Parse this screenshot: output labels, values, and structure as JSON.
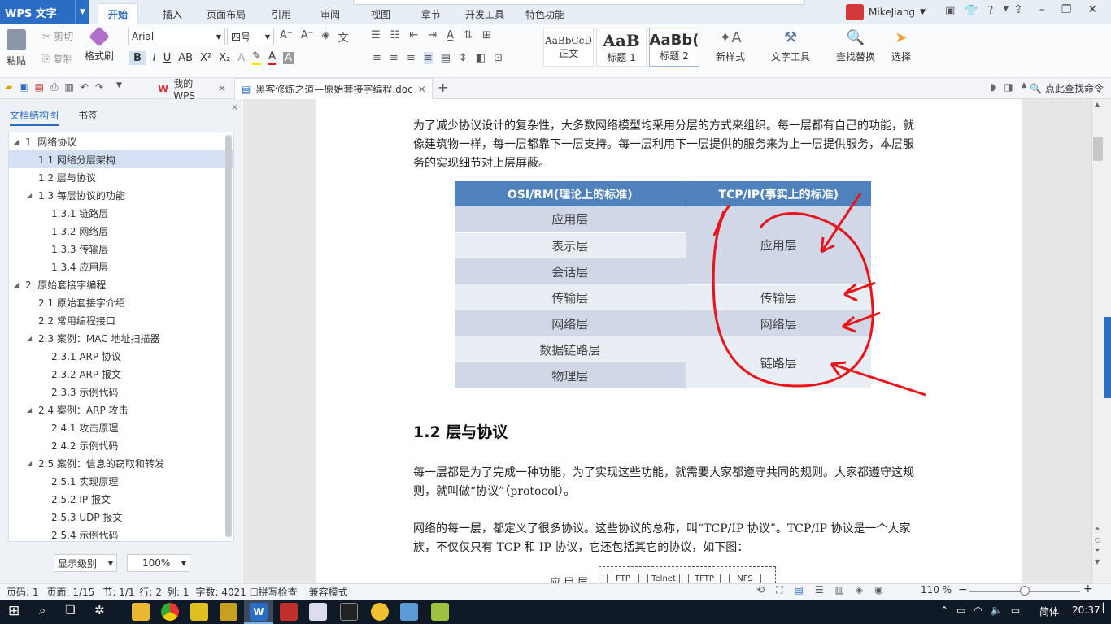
{
  "app": {
    "logo_text": "WPS 文字"
  },
  "menu_tabs": [
    "开始",
    "插入",
    "页面布局",
    "引用",
    "审阅",
    "视图",
    "章节",
    "开发工具",
    "特色功能"
  ],
  "user": {
    "name": "MikeJiang",
    "help": "?"
  },
  "ribbon": {
    "paste": "粘贴",
    "cut": "剪切",
    "copy": "复制",
    "format_painter": "格式刷",
    "font_name": "Arial",
    "font_size": "四号",
    "bold": "B",
    "italic": "I",
    "underline": "U",
    "styles": [
      {
        "preview": "AaBbCcD",
        "label": "正文"
      },
      {
        "preview": "AaB",
        "label": "标题 1"
      },
      {
        "preview": "AaBb(",
        "label": "标题 2"
      }
    ],
    "new_style": "新样式",
    "text_tools": "文字工具",
    "find_replace": "查找替换",
    "select": "选择"
  },
  "quickbar": {
    "tab_my_wps": "我的WPS",
    "tab_doc": "黑客修炼之道—原始套接字编程.doc",
    "find_command": "点此查找命令"
  },
  "nav": {
    "tab_outline": "文档结构图",
    "tab_bookmark": "书签",
    "items": [
      {
        "label": "1. 网络协议",
        "level": 0,
        "expanded": true
      },
      {
        "label": "1.1 网络分层架构",
        "level": 1,
        "selected": true
      },
      {
        "label": "1.2 层与协议",
        "level": 1
      },
      {
        "label": "1.3 每层协议的功能",
        "level": 1,
        "expanded": true
      },
      {
        "label": "1.3.1 链路层",
        "level": 2
      },
      {
        "label": "1.3.2 网络层",
        "level": 2
      },
      {
        "label": "1.3.3 传输层",
        "level": 2
      },
      {
        "label": "1.3.4 应用层",
        "level": 2
      },
      {
        "label": "2. 原始套接字编程",
        "level": 0,
        "expanded": true
      },
      {
        "label": "2.1 原始套接字介绍",
        "level": 1
      },
      {
        "label": "2.2 常用编程接口",
        "level": 1
      },
      {
        "label": "2.3 案例：MAC 地址扫描器",
        "level": 1,
        "expanded": true
      },
      {
        "label": "2.3.1 ARP 协议",
        "level": 2
      },
      {
        "label": "2.3.2 ARP 报文",
        "level": 2
      },
      {
        "label": "2.3.3 示例代码",
        "level": 2
      },
      {
        "label": "2.4 案例：ARP 攻击",
        "level": 1,
        "expanded": true
      },
      {
        "label": "2.4.1 攻击原理",
        "level": 2
      },
      {
        "label": "2.4.2 示例代码",
        "level": 2
      },
      {
        "label": "2.5 案例：信息的窃取和转发",
        "level": 1,
        "expanded": true
      },
      {
        "label": "2.5.1 实现原理",
        "level": 2
      },
      {
        "label": "2.5.2 IP 报文",
        "level": 2
      },
      {
        "label": "2.5.3 UDP 报文",
        "level": 2
      },
      {
        "label": "2.5.4 示例代码",
        "level": 2
      }
    ],
    "display_level": "显示级别",
    "zoom": "100%"
  },
  "document": {
    "para1": "为了减少协议设计的复杂性，大多数网络模型均采用分层的方式来组织。每一层都有自己的功能，就像建筑物一样，每一层都靠下一层支持。每一层利用下一层提供的服务来为上一层提供服务，本层服务的实现细节对上层屏蔽。",
    "table": {
      "headers": [
        "OSI/RM(理论上的标准)",
        "TCP/IP(事实上的标准)"
      ],
      "osi": [
        "应用层",
        "表示层",
        "会话层",
        "传输层",
        "网络层",
        "数据链路层",
        "物理层"
      ],
      "tcpip": [
        "应用层",
        "传输层",
        "网络层",
        "链路层"
      ]
    },
    "heading": "1.2  层与协议",
    "para2": "每一层都是为了完成一种功能，为了实现这些功能，就需要大家都遵守共同的规则。大家都遵守这规则，就叫做“协议”（protocol）。",
    "para3": "网络的每一层，都定义了很多协议。这些协议的总称，叫“TCP/IP 协议”。TCP/IP 协议是一个大家族，不仅仅只有 TCP 和 IP 协议，它还包括其它的协议，如下图：",
    "diagram_label": "应用层",
    "diagram_boxes": [
      "FTP",
      "Telnet",
      "TFTP",
      "NFS"
    ]
  },
  "status": {
    "page_no": "页码: 1",
    "pages": "页面: 1/15",
    "section": "节: 1/1",
    "line": "行: 2",
    "col": "列: 1",
    "words": "字数: 4021",
    "spell": "拼写检查",
    "compat": "兼容模式",
    "zoom": "110 %"
  },
  "taskbar": {
    "lang": "简体",
    "time": "20:37"
  },
  "colors": {
    "accent": "#2b6cc4",
    "table_header": "#4f81bd",
    "annotation": "#e8141c"
  }
}
